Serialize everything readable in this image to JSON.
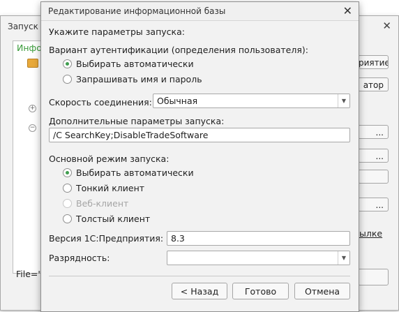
{
  "background_window": {
    "title": "Запуск 1С",
    "tree_header": "Инфо",
    "side_buttons": [
      "риятие",
      "атор",
      "...",
      "...",
      "",
      "..."
    ],
    "link_text": "ылке",
    "file_text": "File=\""
  },
  "dialog": {
    "title": "Редактирование информационной базы",
    "heading": "Укажите параметры запуска:",
    "auth": {
      "label": "Вариант аутентификации (определения пользователя):",
      "options": [
        "Выбирать автоматически",
        "Запрашивать имя и пароль"
      ],
      "selected": 0
    },
    "speed": {
      "label": "Скорость соединения:",
      "value": "Обычная"
    },
    "extra_params": {
      "label": "Дополнительные параметры запуска:",
      "value": "/C SearchKey;DisableTradeSoftware"
    },
    "mode": {
      "label": "Основной режим запуска:",
      "options": [
        "Выбирать автоматически",
        "Тонкий клиент",
        "Веб-клиент",
        "Толстый клиент"
      ],
      "selected": 0,
      "disabled": [
        2
      ]
    },
    "version": {
      "label": "Версия 1С:Предприятия:",
      "value": "8.3"
    },
    "bitness": {
      "label": "Разрядность:",
      "value": ""
    },
    "buttons": {
      "back": "< Назад",
      "finish": "Готово",
      "cancel": "Отмена"
    }
  },
  "colors": {
    "radio_dot": "#3e9d4e",
    "tree_header": "#3a9b3a",
    "disabled_text": "#a5a5a5"
  }
}
